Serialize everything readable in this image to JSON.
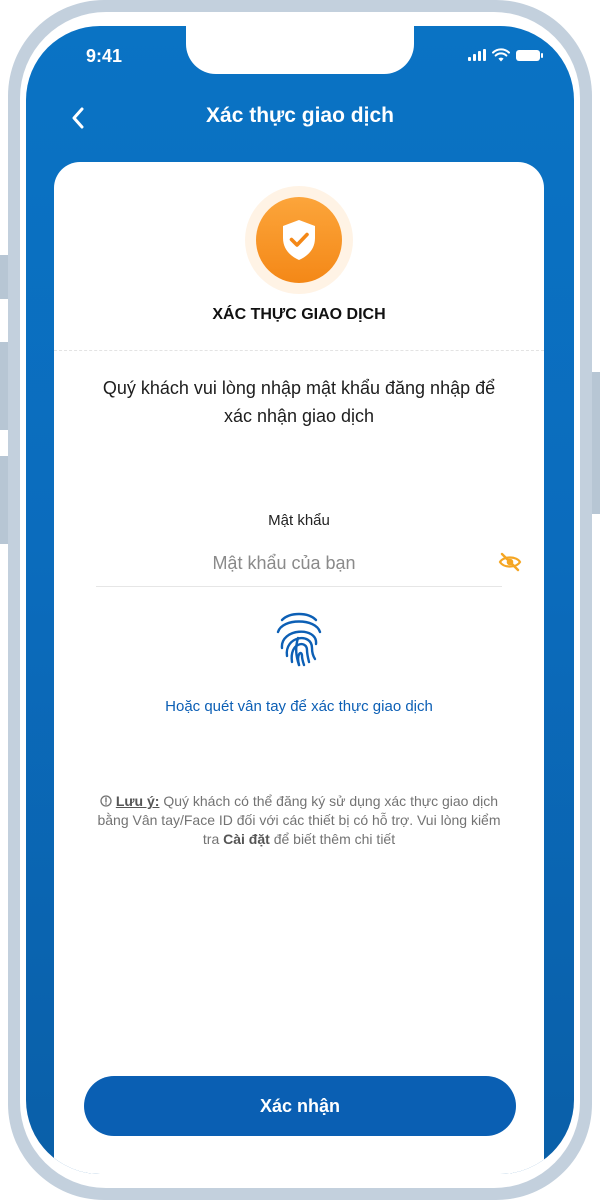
{
  "status_bar": {
    "time": "9:41"
  },
  "header": {
    "title": "Xác thực giao dịch"
  },
  "card": {
    "title": "XÁC THỰC GIAO DỊCH",
    "instruction": "Quý khách vui lòng nhập mật khẩu đăng nhập để xác nhận giao dịch",
    "password": {
      "label": "Mật khẩu",
      "placeholder": "Mật khẩu của bạn",
      "value": ""
    },
    "fingerprint_text": "Hoặc quét vân tay để xác thực giao dịch",
    "note": {
      "label": "Lưu ý:",
      "text_1": "Quý khách có thể đăng ký sử dụng xác thực giao dịch bằng Vân tay/Face ID đối với các thiết bị có hỗ trợ. Vui lòng kiểm tra",
      "bold": "Cài đặt",
      "text_2": "để biết thêm chi tiết"
    }
  },
  "footer": {
    "confirm_label": "Xác nhận"
  },
  "icons": {
    "back": "chevron-left-icon",
    "shield": "shield-check-icon",
    "eye": "eye-off-icon",
    "fingerprint": "fingerprint-icon",
    "info": "info-circle-icon"
  },
  "colors": {
    "primary": "#0a5fb3",
    "header_gradient_top": "#0a73c4",
    "accent_orange": "#f7931e",
    "link_blue": "#0c5fb5"
  }
}
